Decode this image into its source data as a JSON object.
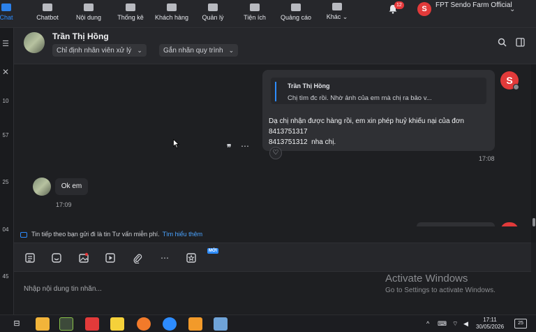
{
  "nav": {
    "items": [
      {
        "label": "Chat",
        "icon": "chat-icon"
      },
      {
        "label": "Chatbot",
        "icon": "robot-icon"
      },
      {
        "label": "Nội dung",
        "icon": "document-icon"
      },
      {
        "label": "Thống kê",
        "icon": "bar-chart-icon"
      },
      {
        "label": "Khách hàng",
        "icon": "users-icon"
      },
      {
        "label": "Quản lý",
        "icon": "gear-icon"
      },
      {
        "label": "Tiện ích",
        "icon": "puzzle-icon"
      },
      {
        "label": "Quảng cáo",
        "icon": "megaphone-icon"
      },
      {
        "label": "Khác",
        "icon": "grid-icon"
      }
    ],
    "chat_badge": "",
    "notification_count": "12",
    "shop_avatar_letter": "S",
    "shop_name": "FPT Sendo Farm Official"
  },
  "left_column": {
    "labels": [
      "10",
      "57",
      "25",
      "04",
      "45"
    ]
  },
  "chat_header": {
    "name": "Trần Thị Hồng",
    "assign_label": "Chỉ định nhân viên xử lý",
    "label_process": "Gắn nhãn quy trình"
  },
  "messages": {
    "outgoing": {
      "quote_name": "Trần Thị Hồng",
      "quote_text": "Chị tìm đc rồi. Nhờ ảnh của em mà chị ra bảo v...",
      "text": "Dạ chị nhận được hàng rồi, em xin phép huỷ khiếu nại của đơn\n8413751317\n8413751312  nha chị.",
      "time": "17:08"
    },
    "incoming": {
      "text": "Ok em",
      "time": "17:09"
    }
  },
  "info_bar": {
    "text": "Tin tiếp theo bạn gửi đi là tin Tư vấn miễn phí.",
    "link": "Tìm hiểu thêm"
  },
  "toolbar": {
    "new_badge": "MỚI"
  },
  "composer": {
    "placeholder": "Nhập nội dung tin nhắn...",
    "value": ""
  },
  "watermark": {
    "title": "Activate Windows",
    "subtitle": "Go to Settings to activate Windows."
  },
  "taskbar": {
    "time": "17:11",
    "date": "30/05/2026",
    "notifications": "25"
  },
  "colors": {
    "accent": "#2d8cff",
    "shop_red": "#e23a3a",
    "background": "#1e1f22"
  }
}
